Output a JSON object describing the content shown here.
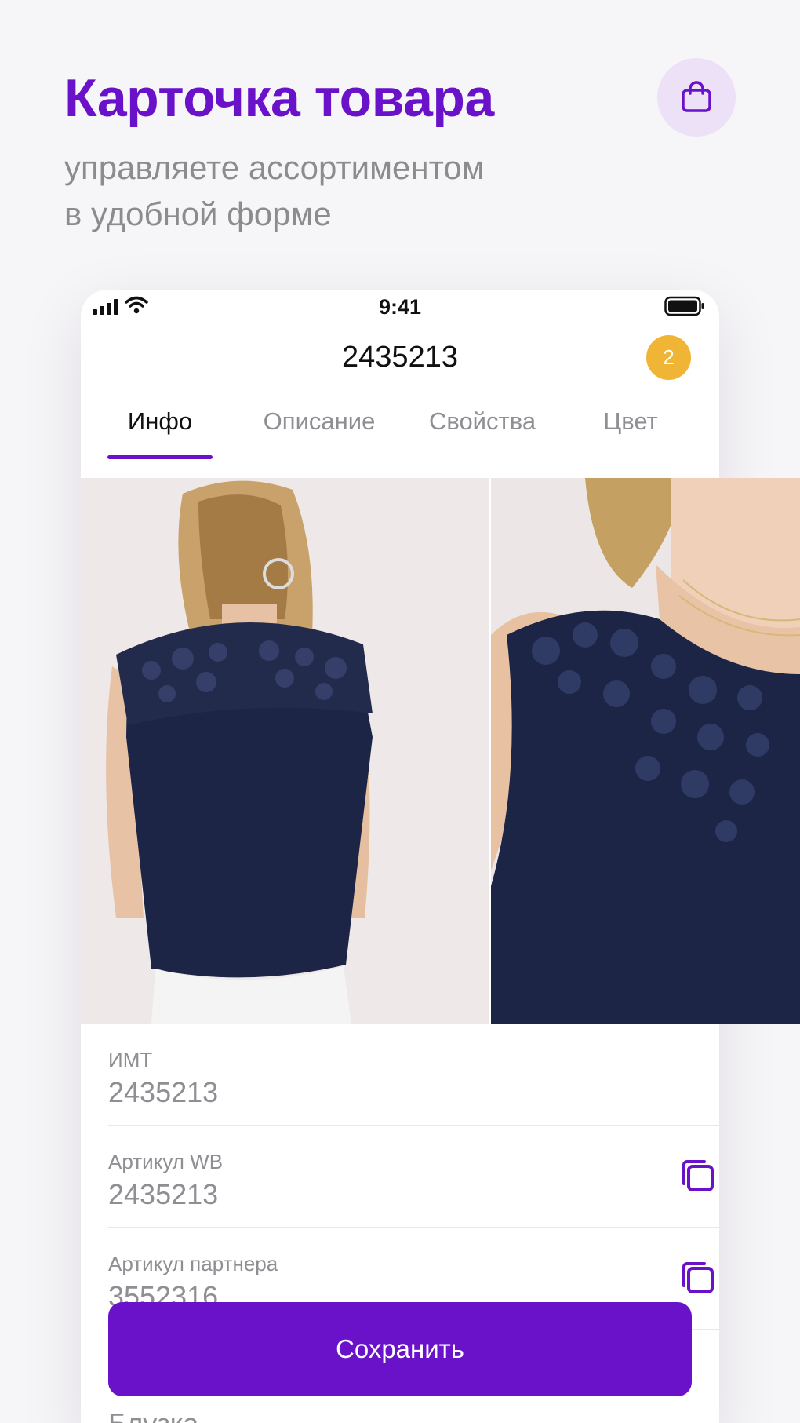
{
  "promo": {
    "title": "Карточка товара",
    "subtitle": "управляете ассортиментом\nв удобной форме",
    "bag_icon": "shopping-bag-icon"
  },
  "status_bar": {
    "time": "9:41"
  },
  "header": {
    "title": "2435213",
    "badge_count": "2"
  },
  "tabs": [
    {
      "label": "Инфо",
      "active": true
    },
    {
      "label": "Описание",
      "active": false
    },
    {
      "label": "Свойства",
      "active": false
    },
    {
      "label": "Цвет",
      "active": false
    }
  ],
  "gallery": {
    "photos": [
      "blouse-back-photo",
      "blouse-front-lace-photo"
    ]
  },
  "fields": [
    {
      "label": "ИМТ",
      "value": "2435213",
      "copy": false
    },
    {
      "label": "Артикул WB",
      "value": "2435213",
      "copy": true
    },
    {
      "label": "Артикул партнера",
      "value": "3552316",
      "copy": true
    }
  ],
  "partial_value": "Блузка",
  "save_button": {
    "label": "Сохранить"
  },
  "colors": {
    "accent": "#6a12c9",
    "badge": "#f1b535",
    "bag_bg": "#ece1f7",
    "muted_text": "#8e8e93"
  }
}
